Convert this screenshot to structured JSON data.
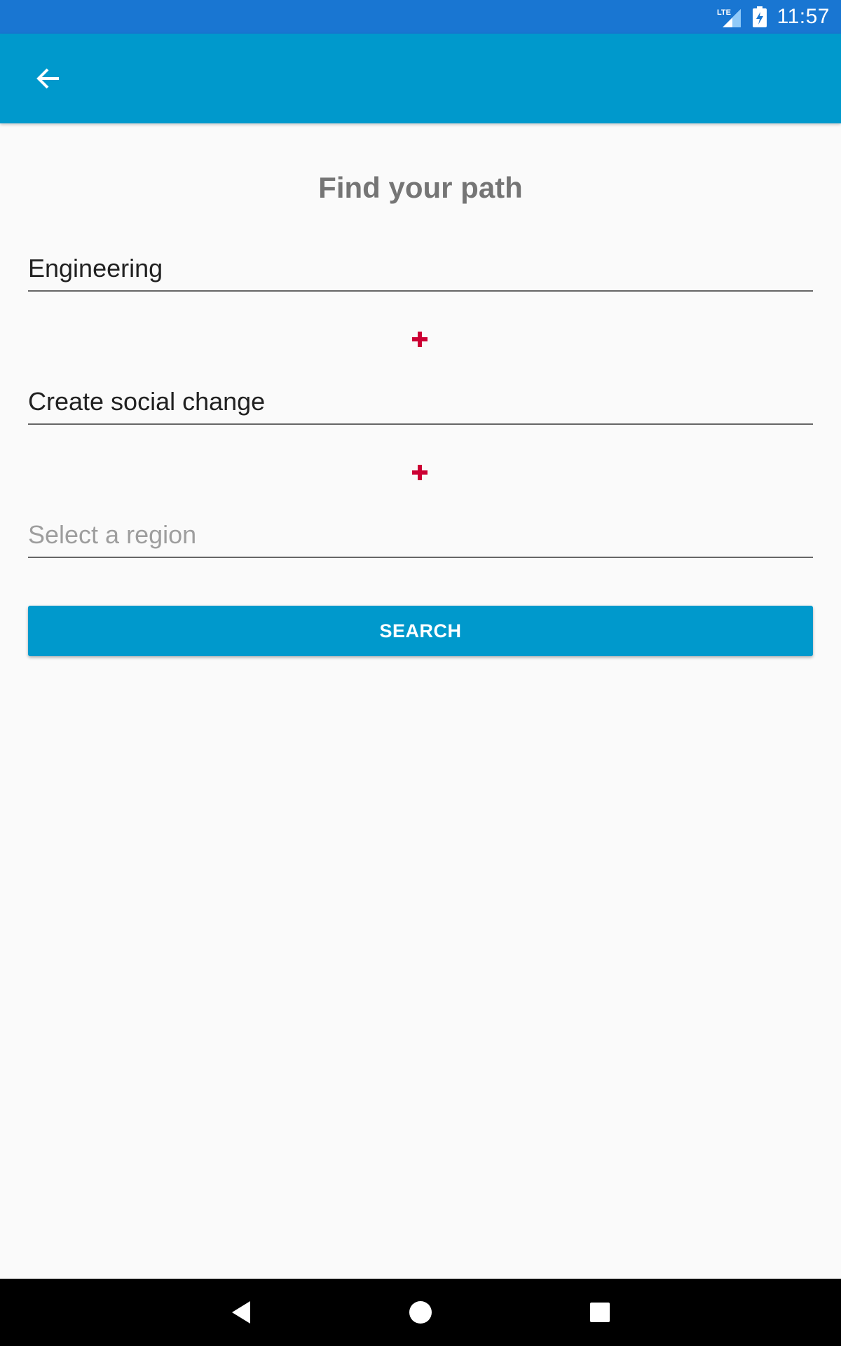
{
  "status_bar": {
    "time": "11:57",
    "network_label": "LTE",
    "icons": [
      "signal-icon",
      "battery-charging-icon"
    ]
  },
  "app_bar": {
    "back_icon": "arrow-back-icon"
  },
  "main": {
    "title": "Find your path",
    "fields": [
      {
        "value": "Engineering",
        "placeholder": ""
      },
      {
        "value": "Create social change",
        "placeholder": ""
      },
      {
        "value": "",
        "placeholder": "Select a region"
      }
    ],
    "plus_icon": "plus-icon",
    "search_label": "SEARCH"
  },
  "nav_bar": {
    "icons": [
      "nav-back-icon",
      "nav-home-icon",
      "nav-recents-icon"
    ]
  },
  "colors": {
    "status_bar": "#1976d2",
    "app_bar": "#0099cc",
    "accent_plus": "#cc0033",
    "button": "#0099cc",
    "background": "#fafafa"
  }
}
